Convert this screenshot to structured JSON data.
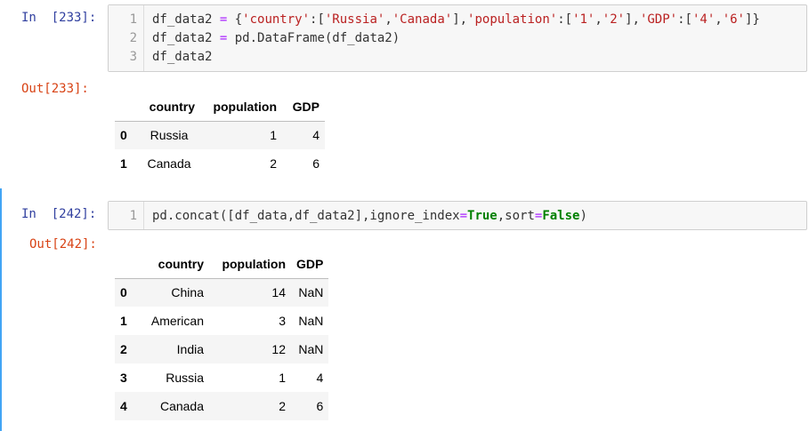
{
  "cells": [
    {
      "in_prompt": "In  [233]:",
      "out_prompt": "Out[233]:",
      "line_numbers": [
        "1",
        "2",
        "3"
      ],
      "code": {
        "line1": {
          "a": "df_data2 ",
          "b": "=",
          "c": " {",
          "s1": "'country'",
          "d": ":[",
          "s2": "'Russia'",
          "e": ",",
          "s3": "'Canada'",
          "f": "],",
          "s4": "'population'",
          "g": ":[",
          "s5": "'1'",
          "h": ",",
          "s6": "'2'",
          "i": "],",
          "s7": "'GDP'",
          "j": ":[",
          "s8": "'4'",
          "k": ",",
          "s9": "'6'",
          "l": "]}"
        },
        "line2": {
          "a": "df_data2 ",
          "b": "=",
          "c": " pd.DataFrame(df_data2)"
        },
        "line3": {
          "a": "df_data2"
        }
      },
      "table": {
        "columns": [
          "country",
          "population",
          "GDP"
        ],
        "rows": [
          {
            "index": "0",
            "values": [
              "Russia",
              "1",
              "4"
            ]
          },
          {
            "index": "1",
            "values": [
              "Canada",
              "2",
              "6"
            ]
          }
        ]
      }
    },
    {
      "in_prompt": "In  [242]:",
      "out_prompt": "Out[242]:",
      "line_numbers": [
        "1"
      ],
      "code": {
        "line1": {
          "a": "pd.concat([df_data,df_data2],ignore_index",
          "b": "=",
          "c": "True",
          "d": ",sort",
          "e": "=",
          "f": "False",
          "g": ")"
        }
      },
      "table": {
        "columns": [
          "country",
          "population",
          "GDP"
        ],
        "rows": [
          {
            "index": "0",
            "values": [
              "China",
              "14",
              "NaN"
            ]
          },
          {
            "index": "1",
            "values": [
              "American",
              "3",
              "NaN"
            ]
          },
          {
            "index": "2",
            "values": [
              "India",
              "12",
              "NaN"
            ]
          },
          {
            "index": "3",
            "values": [
              "Russia",
              "1",
              "4"
            ]
          },
          {
            "index": "4",
            "values": [
              "Canada",
              "2",
              "6"
            ]
          }
        ]
      }
    }
  ],
  "colors": {
    "in_prompt": "#303f9f",
    "out_prompt": "#d84315",
    "keyword": "#008000",
    "string": "#ba2121",
    "operator": "#aa22ff",
    "selected_cell_border": "#42a5f5",
    "input_background": "#f7f7f7"
  }
}
